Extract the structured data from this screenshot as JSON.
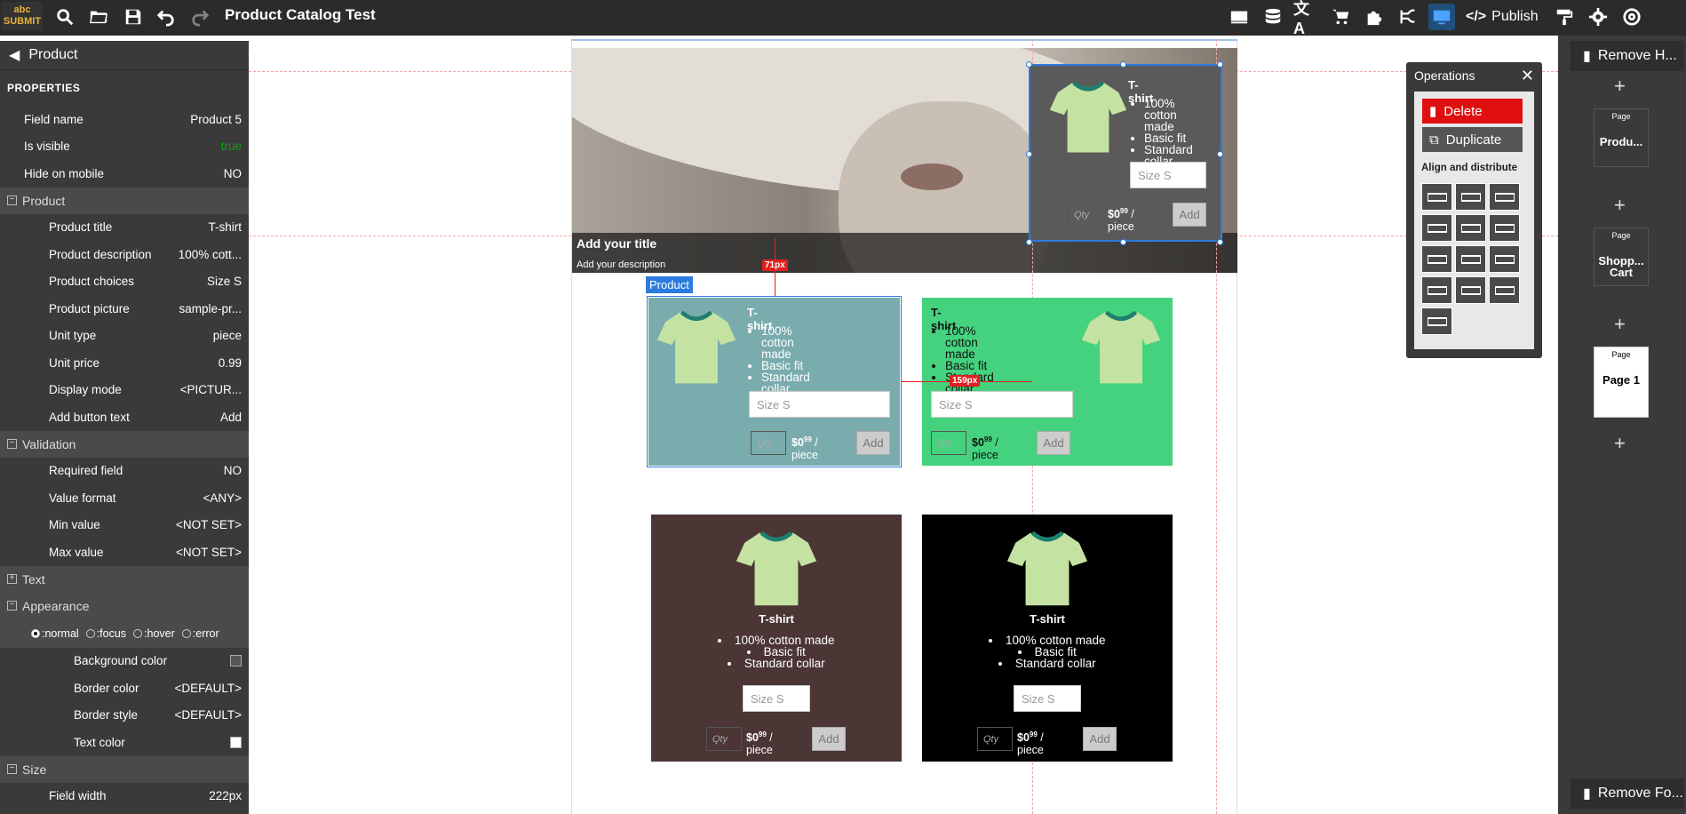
{
  "app": {
    "logo_text": "abc SUBMIT",
    "title": "Product Catalog Test",
    "publish_label": "Publish"
  },
  "toolbar": {
    "left_icons": [
      "search-icon",
      "open-folder-icon",
      "save-icon",
      "undo-icon",
      "redo-icon"
    ],
    "right_icons": [
      "layout-icon",
      "database-icon",
      "translate-icon",
      "cart-icon",
      "puzzle-icon",
      "logic-icon",
      "desktop-icon",
      "code-icon",
      "paint-roller-icon",
      "gear-icon",
      "help-icon"
    ]
  },
  "left_panel": {
    "header": "Product",
    "properties_title": "PROPERTIES",
    "general": [
      {
        "k": "Field name",
        "v": "Product 5"
      },
      {
        "k": "Is visible",
        "v": "true"
      },
      {
        "k": "Hide on mobile",
        "v": "NO"
      }
    ],
    "product_section": "Product",
    "product": [
      {
        "k": "Product title",
        "v": "T-shirt"
      },
      {
        "k": "Product description",
        "v": "100% cott..."
      },
      {
        "k": "Product choices",
        "v": "Size S"
      },
      {
        "k": "Product picture",
        "v": "sample-pr..."
      },
      {
        "k": "Unit type",
        "v": "piece"
      },
      {
        "k": "Unit price",
        "v": "0.99"
      },
      {
        "k": "Display mode",
        "v": "<PICTUR..."
      },
      {
        "k": "Add button text",
        "v": "Add"
      }
    ],
    "validation_section": "Validation",
    "validation": [
      {
        "k": "Required field",
        "v": "NO"
      },
      {
        "k": "Value format",
        "v": "<ANY>"
      },
      {
        "k": "Min value",
        "v": "<NOT SET>"
      },
      {
        "k": "Max value",
        "v": "<NOT SET>"
      }
    ],
    "text_section": "Text",
    "appearance_section": "Appearance",
    "states": [
      ":normal",
      ":focus",
      ":hover",
      ":error"
    ],
    "appearance": [
      {
        "k": "Background color",
        "v": ""
      },
      {
        "k": "Border color",
        "v": "<DEFAULT>"
      },
      {
        "k": "Border style",
        "v": "<DEFAULT>"
      },
      {
        "k": "Text color",
        "v": ""
      }
    ],
    "size_section": "Size",
    "size": [
      {
        "k": "Field width",
        "v": "222px"
      }
    ]
  },
  "hero": {
    "title": "Add your title",
    "description": "Add your description"
  },
  "product_tag": "Product",
  "measures": {
    "vertical": "71px",
    "horizontal": "159px"
  },
  "card_common": {
    "title": "T-shirt",
    "bullets": [
      "100% cotton made",
      "Basic fit",
      "Standard collar"
    ],
    "hero_bullets": [
      "100% cotton made",
      "Basic fit",
      "Standard collar"
    ],
    "size_placeholder": "Size S",
    "qty_placeholder": "Qty",
    "price_main": "$0",
    "price_cents": "99",
    "price_unit": "/ piece",
    "add_label": "Add"
  },
  "cards_colors": {
    "hero_card": "#5a5a5a",
    "teal": "#7aacad",
    "green": "#45d27e",
    "brown": "#4b3535",
    "black": "#000000",
    "selection": "#2d7be0",
    "tee": "#c4e3a2",
    "tee_collar": "#1f7f6e"
  },
  "operations": {
    "title": "Operations",
    "delete_label": "Delete",
    "duplicate_label": "Duplicate",
    "align_label": "Align and distribute"
  },
  "right_panel": {
    "remove_header": "Remove H...",
    "remove_footer": "Remove Fo...",
    "pages": [
      {
        "small": "Page",
        "name": "Produ..."
      },
      {
        "small": "Page",
        "name": "Shopp... Cart"
      },
      {
        "small": "Page",
        "name": "Page 1"
      }
    ]
  }
}
